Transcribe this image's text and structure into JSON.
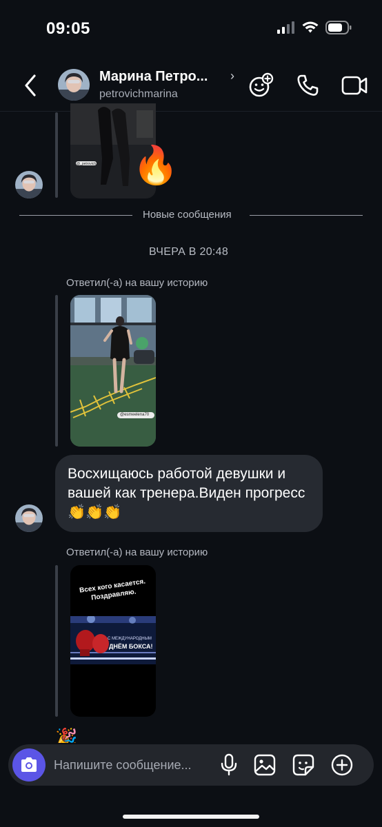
{
  "status_bar": {
    "time": "09:05",
    "signal_icon": "cellular-signal-icon",
    "wifi_icon": "wifi-icon",
    "battery_icon": "battery-icon"
  },
  "header": {
    "back_icon": "chevron-left-icon",
    "contact_name": "Марина Петро...",
    "contact_chevron": "›",
    "contact_handle": "petrovichmarina",
    "actions": [
      "add-effect-icon",
      "phone-icon",
      "video-icon"
    ]
  },
  "chat": {
    "new_messages_label": "Новые сообщения",
    "date_label": "ВЧЕРА В 20:48",
    "story_reply_label_1": "Ответил(-а) на вашу историю",
    "story_reply_label_2": "Ответил(-а) на вашу историю",
    "story_tag_1": "@esmeelena70",
    "story_tag_0": "@_petrovich70",
    "message_text": "Восхищаюсь работой девушки и вашей как тренера.Виден прогресс 👏👏👏",
    "reaction_emoji": "🔥",
    "story_2": {
      "text_top": "Всех кого касается. Поздравляю.",
      "banner_small": "С МЕЖДУНАРОДНЫМ",
      "banner_big": "ДНЁМ БОКСА!"
    },
    "partial_emoji": "🎉"
  },
  "composer": {
    "placeholder": "Напишите сообщение...",
    "camera_icon": "camera-icon",
    "mic_icon": "microphone-icon",
    "gallery_icon": "image-icon",
    "sticker_icon": "sticker-icon",
    "plus_icon": "plus-circle-icon"
  },
  "colors": {
    "background": "#0c0f14",
    "bubble": "#262a31",
    "accent": "#5b55e6"
  }
}
